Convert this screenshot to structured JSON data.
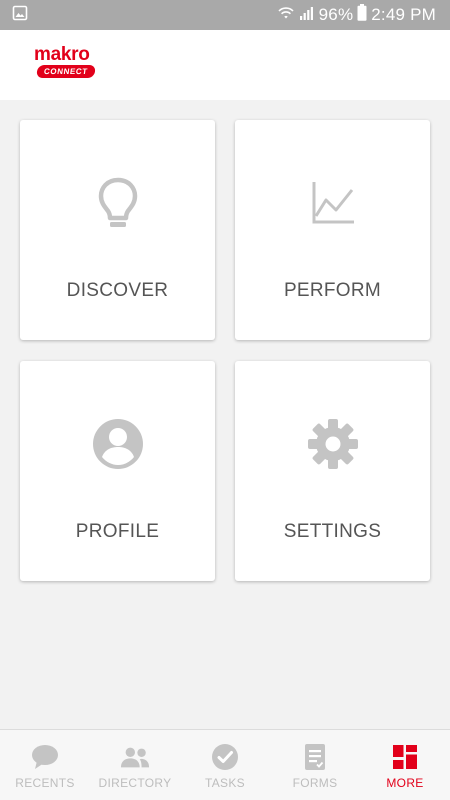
{
  "status_bar": {
    "battery": "96%",
    "time": "2:49 PM"
  },
  "header": {
    "logo_word": "makro",
    "logo_sub": "CONNECT"
  },
  "tiles": [
    {
      "label": "DISCOVER",
      "icon": "lightbulb-icon"
    },
    {
      "label": "PERFORM",
      "icon": "line-chart-icon"
    },
    {
      "label": "PROFILE",
      "icon": "profile-icon"
    },
    {
      "label": "SETTINGS",
      "icon": "gear-icon"
    }
  ],
  "bottom_nav": {
    "items": [
      {
        "label": "RECENTS",
        "icon": "chat-bubble-icon",
        "active": false
      },
      {
        "label": "DIRECTORY",
        "icon": "people-icon",
        "active": false
      },
      {
        "label": "TASKS",
        "icon": "check-circle-icon",
        "active": false
      },
      {
        "label": "FORMS",
        "icon": "clipboard-icon",
        "active": false
      },
      {
        "label": "MORE",
        "icon": "grid-icon",
        "active": true
      }
    ]
  },
  "colors": {
    "brand": "#e2001a",
    "icon_gray": "#c4c4c4",
    "status_bar": "#a9a9a9"
  }
}
